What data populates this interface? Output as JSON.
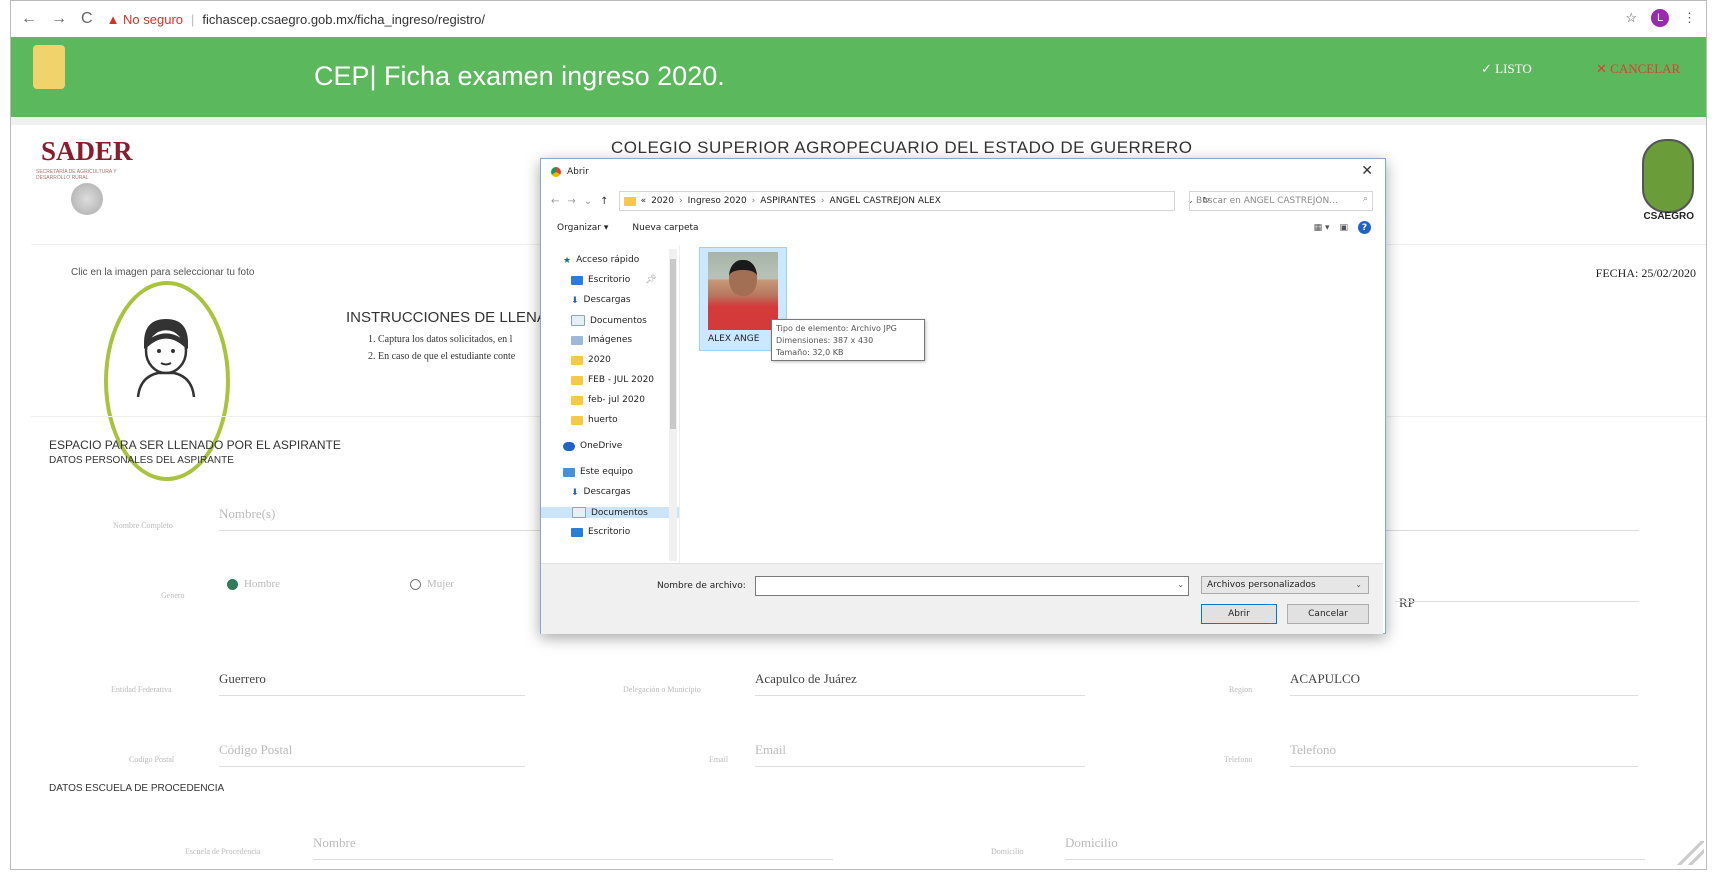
{
  "browser": {
    "security_label": "No seguro",
    "url": "fichascep.csaegro.gob.mx/ficha_ingreso/registro/",
    "avatar_letter": "L"
  },
  "header": {
    "title": "CEP| Ficha examen ingreso 2020.",
    "listo_label": "LISTO",
    "cancelar_label": "CANCELAR",
    "accent_color": "#5cb85c"
  },
  "page": {
    "sader": "SADER",
    "sader_sub": "SECRETARÍA DE AGRICULTURA Y DESARROLLO RURAL",
    "college": "COLEGIO SUPERIOR AGROPECUARIO DEL ESTADO DE GUERRERO",
    "csaegro": "CSAEGRO",
    "clic": "Clic en la imagen para seleccionar tu foto",
    "fecha": "FECHA: 25/02/2020",
    "instr_title": "INSTRUCCIONES DE LLENADO",
    "instr1": "1. Captura los datos solicitados, en l",
    "instr2": "2. En caso de que el estudiante conte",
    "espacio": "ESPACIO PARA SER LLENADO POR EL ASPIRANTE",
    "datos_personales": "DATOS PERSONALES DEL ASPIRANTE",
    "escuela_section": "DATOS ESCUELA DE PROCEDENCIA"
  },
  "form": {
    "nombre_label": "Nombre Completo",
    "nombre_placeholder": "Nombre(s)",
    "genero_label": "Genero",
    "hombre": "Hombre",
    "mujer": "Mujer",
    "curp_fragment": "RP",
    "entidad_label": "Entidad Federativa",
    "entidad_value": "Guerrero",
    "delegacion_label": "Delegación o Municipio",
    "delegacion_value": "Acapulco de Juárez",
    "region_label": "Region",
    "region_value": "ACAPULCO",
    "cp_label": "Codigo Postal",
    "cp_placeholder": "Código Postal",
    "email_label": "Email",
    "email_placeholder": "Email",
    "telefono_label": "Telefono",
    "telefono_placeholder": "Telefono",
    "escuela_label": "Escuela de Procedencia",
    "escuela_placeholder": "Nombre",
    "domicilio_label": "Domicilio",
    "domicilio_placeholder": "Domicilio"
  },
  "dialog": {
    "title": "Abrir",
    "breadcrumb": [
      "«",
      "2020",
      "Ingreso 2020",
      "ASPIRANTES",
      "ANGEL CASTREJON ALEX"
    ],
    "search_placeholder": "Buscar en ANGEL CASTREJON...",
    "organize": "Organizar ▾",
    "new_folder": "Nueva carpeta",
    "nav_items": [
      {
        "label": "Acceso rápido",
        "icon": "star-icon"
      },
      {
        "label": "Escritorio",
        "icon": "desktop-icon"
      },
      {
        "label": "Descargas",
        "icon": "download-icon"
      },
      {
        "label": "Documentos",
        "icon": "documents-icon"
      },
      {
        "label": "Imágenes",
        "icon": "images-icon"
      },
      {
        "label": "2020",
        "icon": "folder-icon"
      },
      {
        "label": "FEB - JUL 2020",
        "icon": "folder-icon"
      },
      {
        "label": "feb- jul 2020",
        "icon": "folder-icon"
      },
      {
        "label": "huerto",
        "icon": "folder-icon"
      },
      {
        "label": "OneDrive",
        "icon": "cloud-icon"
      },
      {
        "label": "Este equipo",
        "icon": "computer-icon"
      },
      {
        "label": "Descargas",
        "icon": "download-icon"
      },
      {
        "label": "Documentos",
        "icon": "documents-icon"
      },
      {
        "label": "Escritorio",
        "icon": "desktop-icon"
      }
    ],
    "file_name": "ALEX ANGE",
    "tooltip": [
      "Tipo de elemento: Archivo JPG",
      "Dimensiones: 387 x 430",
      "Tamaño: 32,0 KB"
    ],
    "filename_label": "Nombre de archivo:",
    "file_type": "Archivos personalizados",
    "open_button": "Abrir",
    "cancel_button": "Cancelar"
  }
}
